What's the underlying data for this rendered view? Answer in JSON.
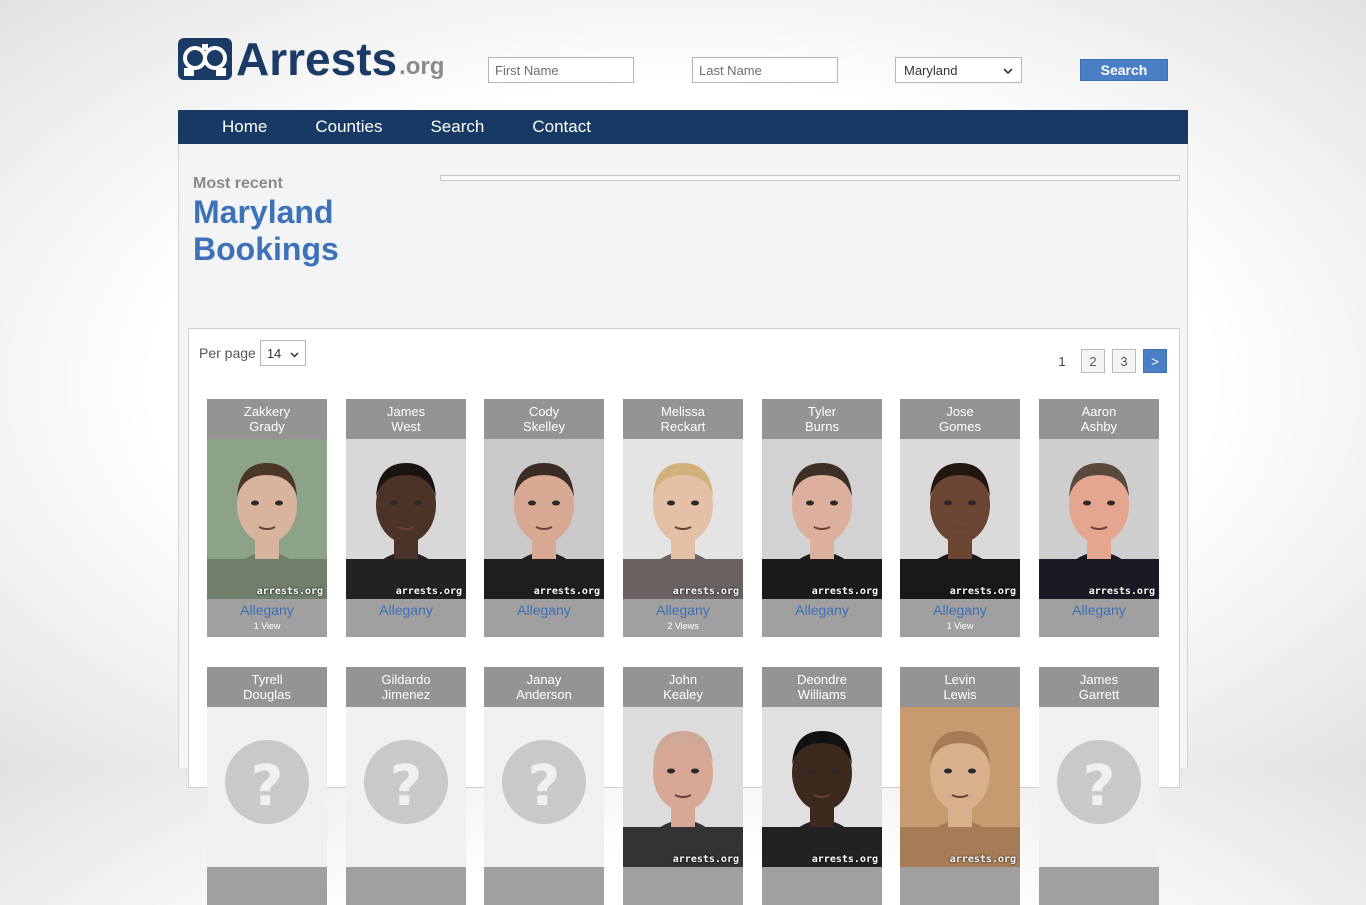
{
  "header": {
    "logo_main": "Arrests",
    "logo_suffix": ".org",
    "first_name_placeholder": "First Name",
    "last_name_placeholder": "Last Name",
    "state_selected": "Maryland",
    "search_label": "Search"
  },
  "nav": {
    "items": [
      "Home",
      "Counties",
      "Search",
      "Contact"
    ]
  },
  "main": {
    "most_recent": "Most recent",
    "title_line1": "Maryland",
    "title_line2": "Bookings",
    "per_page_label": "Per page",
    "per_page_value": "14",
    "pages": [
      "1",
      "2",
      "3",
      ">"
    ]
  },
  "cards": [
    {
      "first": "Zakkery",
      "last": "Grady",
      "county": "Allegany",
      "views": "1 View",
      "bg": "#8ca38a",
      "skin": "#d9b49c",
      "hair": "#4a3726",
      "shirt": "#6f7f6b"
    },
    {
      "first": "James",
      "last": "West",
      "county": "Allegany",
      "views": "",
      "bg": "#d8d8d8",
      "skin": "#4b3327",
      "hair": "#1a1410",
      "shirt": "#222222"
    },
    {
      "first": "Cody",
      "last": "Skelley",
      "county": "Allegany",
      "views": "",
      "bg": "#c9c9c9",
      "skin": "#d7a993",
      "hair": "#3b2d24",
      "shirt": "#1e1e1e"
    },
    {
      "first": "Melissa",
      "last": "Reckart",
      "county": "Allegany",
      "views": "2 Views",
      "bg": "#e4e4e4",
      "skin": "#e3c0a6",
      "hair": "#d2b27a",
      "shirt": "#6a6260"
    },
    {
      "first": "Tyler",
      "last": "Burns",
      "county": "Allegany",
      "views": "",
      "bg": "#d2d2d2",
      "skin": "#dcb09c",
      "hair": "#3e2f24",
      "shirt": "#1b1b1b"
    },
    {
      "first": "Jose",
      "last": "Gomes",
      "county": "Allegany",
      "views": "1 View",
      "bg": "#dadada",
      "skin": "#6b4633",
      "hair": "#22170f",
      "shirt": "#181818"
    },
    {
      "first": "Aaron",
      "last": "Ashby",
      "county": "Allegany",
      "views": "",
      "bg": "#cfcfcf",
      "skin": "#e4a68f",
      "hair": "#5a4a3e",
      "shirt": "#1a1a26"
    },
    {
      "first": "Tyrell",
      "last": "Douglas",
      "county": "",
      "views": "",
      "placeholder": true
    },
    {
      "first": "Gildardo",
      "last": "Jimenez",
      "county": "",
      "views": "",
      "placeholder": true
    },
    {
      "first": "Janay",
      "last": "Anderson",
      "county": "",
      "views": "",
      "placeholder": true
    },
    {
      "first": "John",
      "last": "Kealey",
      "county": "",
      "views": "",
      "bg": "#dcdcdc",
      "skin": "#d8a894",
      "hair": "#cfa996",
      "shirt": "#333333"
    },
    {
      "first": "Deondre",
      "last": "Williams",
      "county": "",
      "views": "",
      "bg": "#e0e0e0",
      "skin": "#3d281d",
      "hair": "#111111",
      "shirt": "#222222"
    },
    {
      "first": "Levin",
      "last": "Lewis",
      "county": "",
      "views": "",
      "bg": "#c79a70",
      "skin": "#d9b08c",
      "hair": "#a57c56",
      "shirt": "#a57c56"
    },
    {
      "first": "James",
      "last": "Garrett",
      "county": "",
      "views": "",
      "placeholder": true
    }
  ],
  "watermark": "arrests.org",
  "placeholder_glyph": "?",
  "colors": {
    "nav": "#163a63",
    "accent": "#4a7fc6",
    "title": "#3d72b8"
  }
}
